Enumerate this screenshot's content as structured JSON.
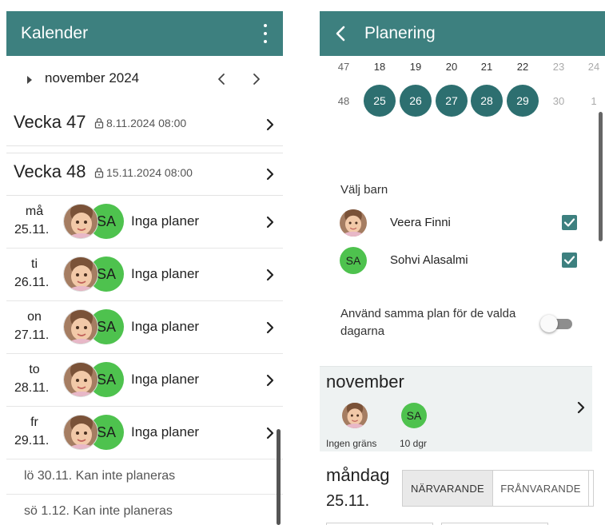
{
  "left": {
    "title": "Kalender",
    "month": "november 2024",
    "weeks": [
      {
        "label": "Vecka 47",
        "deadline": "8.11.2024 08:00"
      },
      {
        "label": "Vecka 48",
        "deadline": "15.11.2024 08:00"
      }
    ],
    "days": [
      {
        "name": "må",
        "date": "25.11.",
        "initials": "SA",
        "status": "Inga planer"
      },
      {
        "name": "ti",
        "date": "26.11.",
        "initials": "SA",
        "status": "Inga planer"
      },
      {
        "name": "on",
        "date": "27.11.",
        "initials": "SA",
        "status": "Inga planer"
      },
      {
        "name": "to",
        "date": "28.11.",
        "initials": "SA",
        "status": "Inga planer"
      },
      {
        "name": "fr",
        "date": "29.11.",
        "initials": "SA",
        "status": "Inga planer"
      }
    ],
    "unplannable": [
      "lö 30.11. Kan inte planeras",
      "sö 1.12. Kan inte planeras"
    ]
  },
  "right": {
    "title": "Planering",
    "calendar": {
      "row1": {
        "week": "47",
        "days": [
          "18",
          "19",
          "20",
          "21",
          "22",
          "23",
          "24"
        ]
      },
      "row2": {
        "week": "48",
        "days": [
          "25",
          "26",
          "27",
          "28",
          "29",
          "30",
          "1"
        ]
      },
      "selected": [
        "25",
        "26",
        "27",
        "28",
        "29"
      ]
    },
    "choose_children_label": "Välj barn",
    "children": [
      {
        "name": "Veera Finni",
        "checked": true
      },
      {
        "name": "Sohvi Alasalmi",
        "initials": "SA",
        "checked": true
      }
    ],
    "same_plan_label": "Använd samma plan för de valda dagarna",
    "same_plan_enabled": false,
    "month_card": {
      "title": "november",
      "child1_limit": "Ingen gräns",
      "child2_initials": "SA",
      "child2_days": "10 dgr"
    },
    "day": {
      "weekday": "måndag",
      "date": "25.11.",
      "present_label": "NÄRVARANDE",
      "absent_label": "FRÅNVARANDE"
    }
  },
  "colors": {
    "header": "#3d807f",
    "selected_day": "#2d6f70",
    "avatar_green": "#4ec24e",
    "card_bg": "#eef2f2"
  }
}
